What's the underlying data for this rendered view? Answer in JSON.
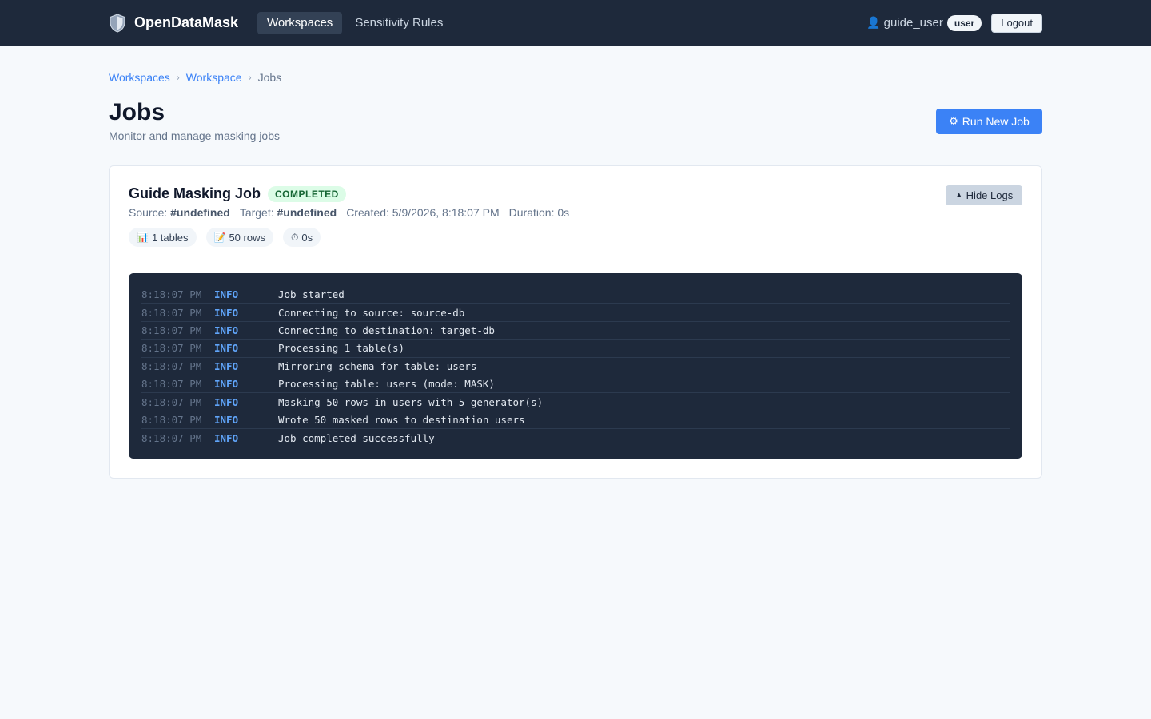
{
  "app": {
    "brand": "OpenDataMask",
    "logo_icon": "shield-icon"
  },
  "nav": {
    "items": [
      {
        "label": "Workspaces",
        "active": true
      },
      {
        "label": "Sensitivity Rules",
        "active": false
      }
    ],
    "user": {
      "name": "guide_user",
      "role": "user"
    },
    "logout_label": "Logout"
  },
  "breadcrumb": {
    "items": [
      "Workspaces",
      "Workspace"
    ],
    "separator": "›",
    "current": "Jobs"
  },
  "page": {
    "title": "Jobs",
    "subtitle": "Monitor and manage masking jobs",
    "run_button_label": "Run New Job",
    "run_button_icon": "⚙"
  },
  "job": {
    "title": "Guide Masking Job",
    "status": "COMPLETED",
    "hide_logs_label": "Hide Logs",
    "hide_logs_icon": "▲",
    "meta": {
      "source_label": "Source:",
      "source_value": "#undefined",
      "target_label": "Target:",
      "target_value": "#undefined",
      "created": "Created: 5/9/2026, 8:18:07 PM",
      "duration": "Duration: 0s"
    },
    "chips": [
      {
        "icon": "📊",
        "label": "1 tables"
      },
      {
        "icon": "📝",
        "label": "50 rows"
      },
      {
        "icon": "⏱",
        "label": "0s"
      }
    ],
    "logs": [
      {
        "time": "8:18:07 PM",
        "level": "INFO",
        "message": "Job started"
      },
      {
        "time": "8:18:07 PM",
        "level": "INFO",
        "message": "Connecting to source: source-db"
      },
      {
        "time": "8:18:07 PM",
        "level": "INFO",
        "message": "Connecting to destination: target-db"
      },
      {
        "time": "8:18:07 PM",
        "level": "INFO",
        "message": "Processing 1 table(s)"
      },
      {
        "time": "8:18:07 PM",
        "level": "INFO",
        "message": "Mirroring schema for table: users"
      },
      {
        "time": "8:18:07 PM",
        "level": "INFO",
        "message": "Processing table: users (mode: MASK)"
      },
      {
        "time": "8:18:07 PM",
        "level": "INFO",
        "message": "Masking 50 rows in users with 5 generator(s)"
      },
      {
        "time": "8:18:07 PM",
        "level": "INFO",
        "message": "Wrote 50 masked rows to destination users"
      },
      {
        "time": "8:18:07 PM",
        "level": "INFO",
        "message": "Job completed successfully"
      }
    ]
  },
  "colors": {
    "navbar_bg": "#1e293b",
    "accent": "#3b82f6",
    "status_completed_bg": "#dcfce7",
    "status_completed_text": "#166534",
    "log_level_info": "#60a5fa"
  }
}
